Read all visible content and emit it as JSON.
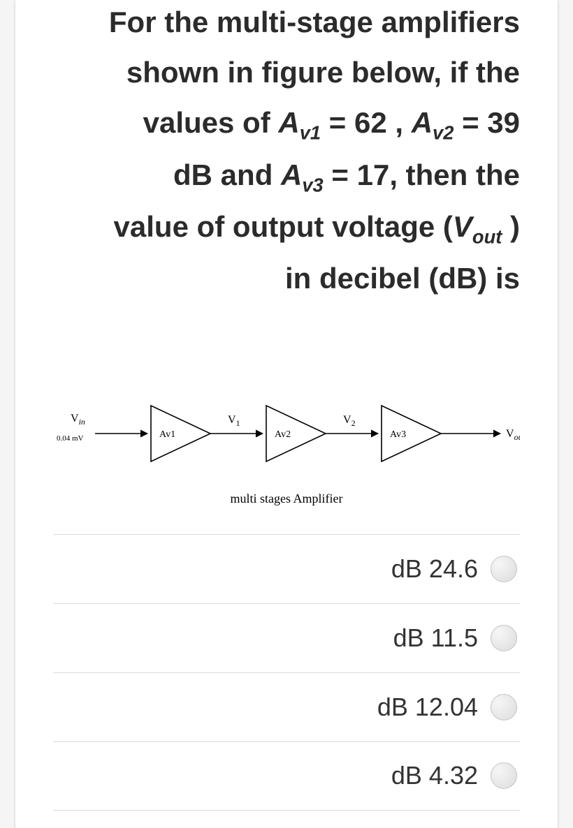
{
  "question": {
    "line1": "For the multi-stage amplifiers",
    "line2": "shown in figure below, if the",
    "line3_prefix": "values of  ",
    "av1_sym": "A",
    "av1_sub": "v1",
    "av1_eq": " = 62  , ",
    "av2_sym": "A",
    "av2_sub": "v2",
    "av2_eq": " = 39",
    "line4_prefix": "dB  and  ",
    "av3_sym": "A",
    "av3_sub": "v3",
    "av3_eq": " = 17,  then the",
    "line5_prefix": "value of output voltage (",
    "vout_sym": "V",
    "vout_sub": "out",
    "line5_suffix": " )",
    "line6": "in decibel (dB) is"
  },
  "figure": {
    "vin_label": "V",
    "vin_sub": "in",
    "vin_source": "0.04 mV",
    "a1": "Av1",
    "v1_label": "V",
    "v1_sub": "1",
    "a2": "Av2",
    "v2_label": "V",
    "v2_sub": "2",
    "a3": "Av3",
    "vout_label": "V",
    "vout_sub": "out",
    "caption": "multi stages Amplifier"
  },
  "options": [
    {
      "label": "dB 24.6"
    },
    {
      "label": "dB 11.5"
    },
    {
      "label": "dB 12.04"
    },
    {
      "label": "dB 4.32"
    }
  ]
}
